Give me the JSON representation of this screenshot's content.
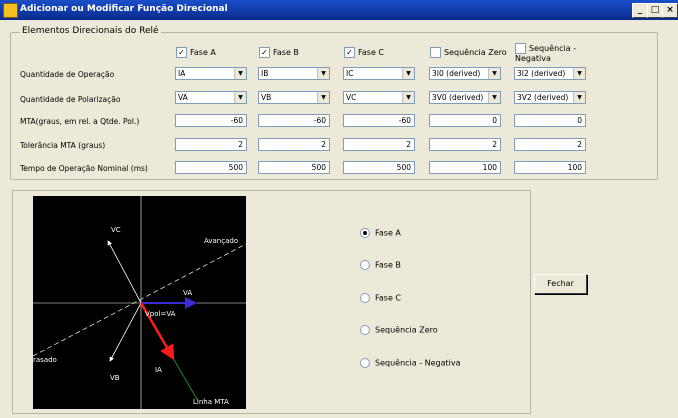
{
  "window": {
    "title": "Adicionar ou Modificar Função Direcional",
    "min": "_",
    "max": "□",
    "close": "×"
  },
  "group": {
    "title": "Elementos Direcionais do Relé"
  },
  "columns": [
    {
      "label": "Fase A",
      "checked": true,
      "operacao": "IA",
      "polarizacao": "VA",
      "mta": "-60",
      "tol": "2",
      "tempo": "500"
    },
    {
      "label": "Fase B",
      "checked": true,
      "operacao": "IB",
      "polarizacao": "VB",
      "mta": "-60",
      "tol": "2",
      "tempo": "500"
    },
    {
      "label": "Fase C",
      "checked": true,
      "operacao": "IC",
      "polarizacao": "VC",
      "mta": "-60",
      "tol": "2",
      "tempo": "500"
    },
    {
      "label": "Sequência Zero",
      "checked": false,
      "operacao": "3I0 (derived)",
      "polarizacao": "3V0 (derived)",
      "mta": "0",
      "tol": "2",
      "tempo": "100"
    },
    {
      "label": "Sequência - Negativa",
      "checked": false,
      "operacao": "3I2 (derived)",
      "polarizacao": "3V2 (derived)",
      "mta": "0",
      "tol": "2",
      "tempo": "100"
    }
  ],
  "rows": {
    "operacao": "Quantidade de Operação",
    "polarizacao": "Quantidade de Polarização",
    "mta": "MTA(graus, em rel. a Qtde. Pol.)",
    "tol": "Tolerância MTA (graus)",
    "tempo": "Tempo de Operação Nominal (ms)"
  },
  "plot": {
    "labels": {
      "vc": "VC",
      "va": "VA",
      "vb": "VB",
      "ia": "IA",
      "vpol": "Vpol=VA",
      "avancado": "Avançado",
      "atrasado": "rasado",
      "mta": "Linha MTA"
    },
    "colors": {
      "background": "#000000",
      "axes": "#ffffff",
      "phasor": "#ffffff",
      "va": "#3a2ad8",
      "ia": "#ff1a1a",
      "mta": "#1aa81a"
    }
  },
  "radios": [
    {
      "label": "Fase A",
      "selected": true
    },
    {
      "label": "Fase B",
      "selected": false
    },
    {
      "label": "Fase C",
      "selected": false
    },
    {
      "label": "Sequência Zero",
      "selected": false
    },
    {
      "label": "Sequência - Negativa",
      "selected": false
    }
  ],
  "buttons": {
    "fechar": "Fechar"
  }
}
